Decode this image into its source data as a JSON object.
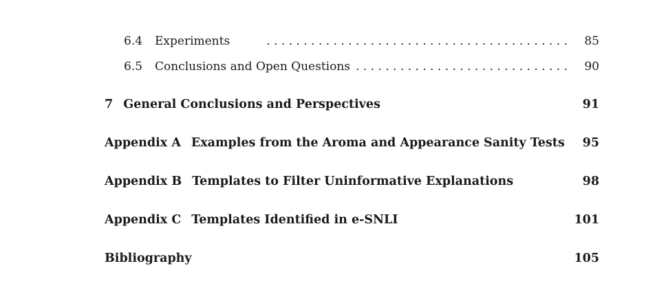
{
  "toc": {
    "sections": [
      {
        "number": "6.4",
        "title": "Experiments",
        "leader": ". . . . . . . . . . . . . . . . . . . . . . . . . . . . . . . . . . . . . . . . .",
        "page": "85"
      },
      {
        "number": "6.5",
        "title": "Conclusions and Open Questions",
        "leader": ". . . . . . . . . . . . . . . . . . . . . . . . . . . . . . . . . .",
        "page": "90"
      }
    ],
    "chapters": [
      {
        "number": "7",
        "title": "General Conclusions and Perspectives",
        "page": "91"
      },
      {
        "number": "Appendix A",
        "title": "Examples from the Aroma and Appearance Sanity Tests",
        "page": "95"
      },
      {
        "number": "Appendix B",
        "title": "Templates to Filter Uninformative Explanations",
        "page": "98"
      },
      {
        "number": "Appendix C",
        "title": "Templates Identified in e-SNLI",
        "page": "101"
      },
      {
        "number": "",
        "title": "Bibliography",
        "page": "105"
      }
    ]
  }
}
